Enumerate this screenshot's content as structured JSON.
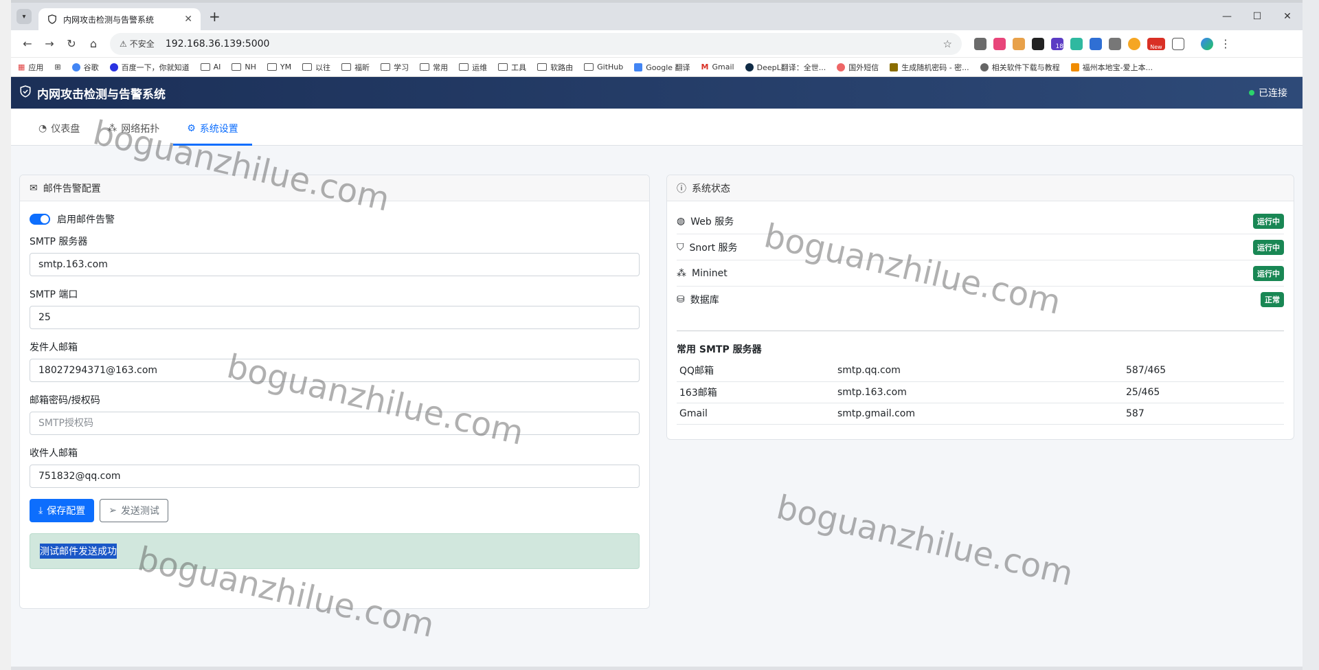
{
  "browser": {
    "tab_title": "内网攻击检测与告警系统",
    "security_label": "不安全",
    "url": "192.168.36.139:5000",
    "bookmarks": [
      "应用",
      "谷歌",
      "百度一下，你就知道",
      "AI",
      "NH",
      "YM",
      "以往",
      "福昕",
      "学习",
      "常用",
      "运维",
      "工具",
      "软路由",
      "GitHub",
      "Google 翻译",
      "Gmail",
      "DeepL翻译：全世...",
      "国外短信",
      "生成随机密码 - 密...",
      "相关软件下载与教程",
      "福州本地宝-爱上本..."
    ],
    "badge_new": "New",
    "badge_count": "18"
  },
  "app": {
    "title": "内网攻击检测与告警系统",
    "connection_status": "已连接"
  },
  "nav": {
    "tabs": [
      "仪表盘",
      "网络拓扑",
      "系统设置"
    ],
    "active": "系统设置"
  },
  "email_config": {
    "header": "邮件告警配置",
    "enable_label": "启用邮件告警",
    "smtp_server_label": "SMTP 服务器",
    "smtp_server_value": "smtp.163.com",
    "smtp_port_label": "SMTP 端口",
    "smtp_port_value": "25",
    "sender_label": "发件人邮箱",
    "sender_value": "18027294371@163.com",
    "password_label": "邮箱密码/授权码",
    "password_placeholder": "SMTP授权码",
    "recipient_label": "收件人邮箱",
    "recipient_value": "751832@qq.com",
    "save_button": "保存配置",
    "test_button": "发送测试",
    "alert_message": "测试邮件发送成功"
  },
  "system_status": {
    "header": "系统状态",
    "services": [
      {
        "name": "Web 服务",
        "status": "运行中"
      },
      {
        "name": "Snort 服务",
        "status": "运行中"
      },
      {
        "name": "Mininet",
        "status": "运行中"
      },
      {
        "name": "数据库",
        "status": "正常"
      }
    ],
    "smtp_title": "常用 SMTP 服务器",
    "smtp_servers": [
      {
        "provider": "QQ邮箱",
        "host": "smtp.qq.com",
        "port": "587/465"
      },
      {
        "provider": "163邮箱",
        "host": "smtp.163.com",
        "port": "25/465"
      },
      {
        "provider": "Gmail",
        "host": "smtp.gmail.com",
        "port": "587"
      }
    ]
  },
  "watermark": "boguanzhilue.com",
  "colors": {
    "primary": "#0d6efd",
    "success": "#198754",
    "header_bg": "#1b2f57"
  }
}
